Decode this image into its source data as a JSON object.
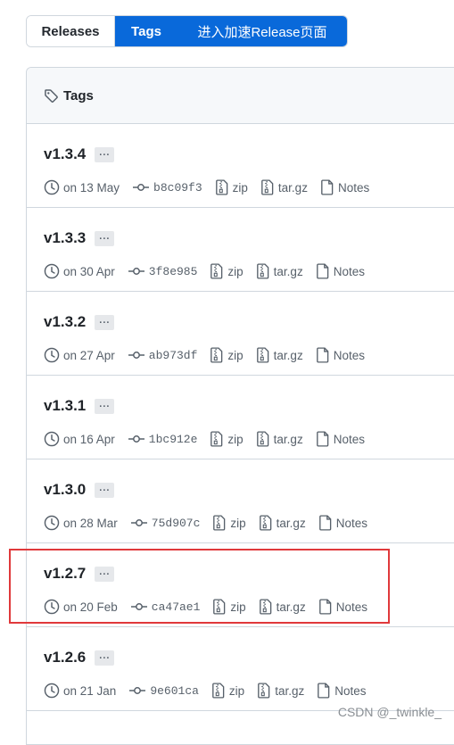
{
  "tabs": {
    "releases": "Releases",
    "tags": "Tags",
    "accelerate": "进入加速Release页面"
  },
  "header": {
    "title": "Tags"
  },
  "tags": [
    {
      "name": "v1.3.4",
      "ellipsis": "...",
      "date": "on 13 May",
      "commit": "b8c09f3",
      "zip": "zip",
      "targz": "tar.gz",
      "notes": "Notes"
    },
    {
      "name": "v1.3.3",
      "ellipsis": "...",
      "date": "on 30 Apr",
      "commit": "3f8e985",
      "zip": "zip",
      "targz": "tar.gz",
      "notes": "Notes"
    },
    {
      "name": "v1.3.2",
      "ellipsis": "...",
      "date": "on 27 Apr",
      "commit": "ab973df",
      "zip": "zip",
      "targz": "tar.gz",
      "notes": "Notes"
    },
    {
      "name": "v1.3.1",
      "ellipsis": "...",
      "date": "on 16 Apr",
      "commit": "1bc912e",
      "zip": "zip",
      "targz": "tar.gz",
      "notes": "Notes"
    },
    {
      "name": "v1.3.0",
      "ellipsis": "...",
      "date": "on 28 Mar",
      "commit": "75d907c",
      "zip": "zip",
      "targz": "tar.gz",
      "notes": "Notes"
    },
    {
      "name": "v1.2.7",
      "ellipsis": "...",
      "date": "on 20 Feb",
      "commit": "ca47ae1",
      "zip": "zip",
      "targz": "tar.gz",
      "notes": "Notes"
    },
    {
      "name": "v1.2.6",
      "ellipsis": "...",
      "date": "on 21 Jan",
      "commit": "9e601ca",
      "zip": "zip",
      "targz": "tar.gz",
      "notes": "Notes"
    }
  ],
  "watermark": "CSDN @_twinkle_",
  "colors": {
    "accent": "#0969da",
    "highlight": "#e0393b",
    "muted": "#57606a"
  }
}
